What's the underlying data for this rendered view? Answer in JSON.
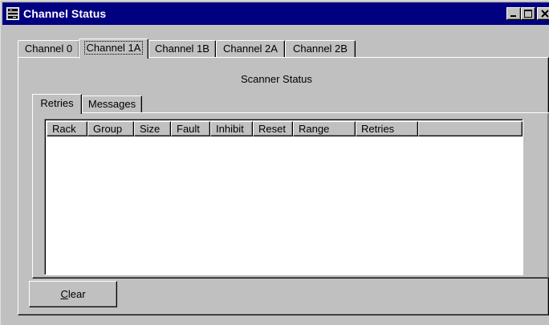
{
  "window": {
    "title": "Channel Status",
    "icon": "channel-status-icon",
    "controls": [
      "minimize-icon",
      "maximize-icon",
      "close-icon"
    ]
  },
  "channel_tabs": [
    {
      "label": "Channel 0",
      "active": false
    },
    {
      "label": "Channel 1A",
      "active": true
    },
    {
      "label": "Channel 1B",
      "active": false
    },
    {
      "label": "Channel 2A",
      "active": false
    },
    {
      "label": "Channel 2B",
      "active": false
    }
  ],
  "panel": {
    "heading": "Scanner Status",
    "sub_tabs": [
      {
        "label": "Retries",
        "active": true
      },
      {
        "label": "Messages",
        "active": false
      }
    ],
    "columns": [
      "Rack",
      "Group",
      "Size",
      "Fault",
      "Inhibit",
      "Reset",
      "Range",
      "Retries"
    ],
    "rows": []
  },
  "buttons": {
    "clear_mnemonic": "C",
    "clear_rest": "lear"
  }
}
